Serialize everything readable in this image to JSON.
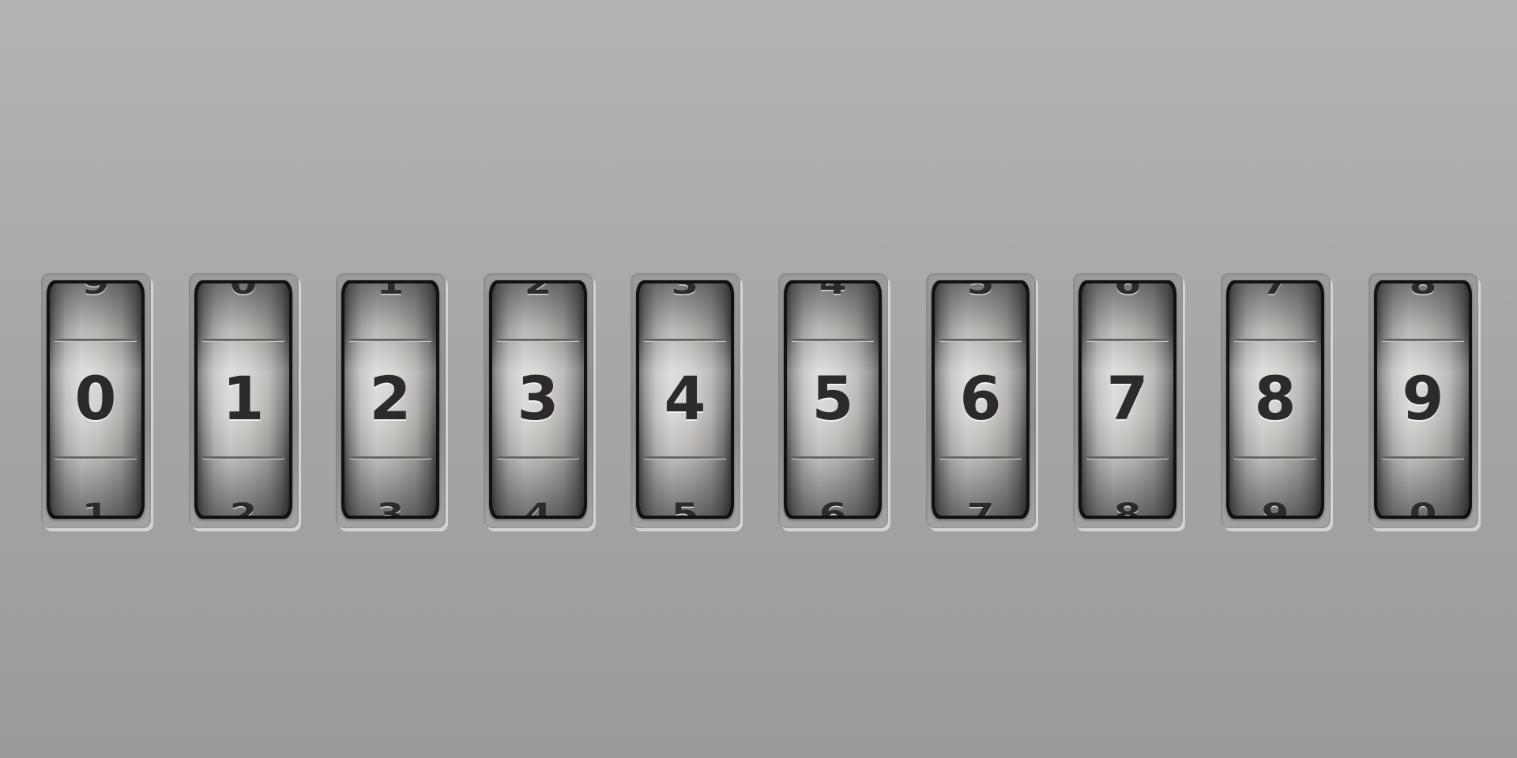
{
  "wheels": [
    {
      "above": "9",
      "current": "0",
      "below": "1"
    },
    {
      "above": "0",
      "current": "1",
      "below": "2"
    },
    {
      "above": "1",
      "current": "2",
      "below": "3"
    },
    {
      "above": "2",
      "current": "3",
      "below": "4"
    },
    {
      "above": "3",
      "current": "4",
      "below": "5"
    },
    {
      "above": "4",
      "current": "5",
      "below": "6"
    },
    {
      "above": "5",
      "current": "6",
      "below": "7"
    },
    {
      "above": "6",
      "current": "7",
      "below": "8"
    },
    {
      "above": "7",
      "current": "8",
      "below": "9"
    },
    {
      "above": "8",
      "current": "9",
      "below": "0"
    }
  ],
  "colors": {
    "background": "#a8a8a8",
    "frame": "#111111",
    "digit": "#2b2b2b"
  }
}
